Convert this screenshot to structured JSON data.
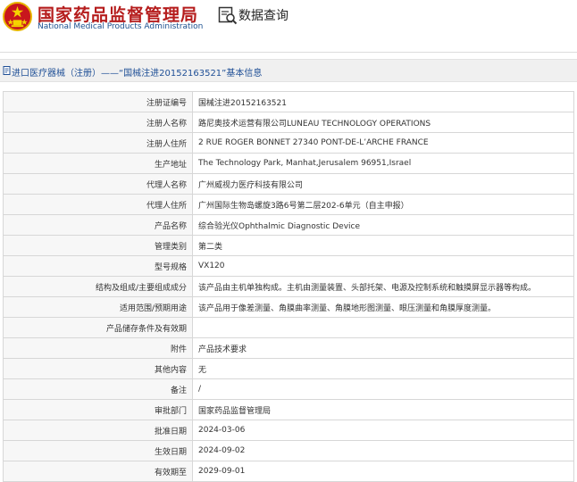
{
  "header": {
    "brand_cn": "国家药品监督管理局",
    "brand_en": "National Medical Products Administration",
    "search_label": "数据查询",
    "brand_color": "#b51c1c",
    "en_color": "#1b4f8f"
  },
  "breadcrumb": {
    "text": "进口医疗器械（注册）——“国械注进20152163521”基本信息",
    "color": "#1f4f96"
  },
  "details": {
    "rows": [
      {
        "label": "注册证编号",
        "value": "国械注进20152163521"
      },
      {
        "label": "注册人名称",
        "value": "路尼奥技术运营有限公司LUNEAU TECHNOLOGY OPERATIONS"
      },
      {
        "label": "注册人住所",
        "value": "2 RUE ROGER BONNET 27340 PONT-DE-L’ARCHE FRANCE"
      },
      {
        "label": "生产地址",
        "value": "The Technology Park, Manhat,Jerusalem 96951,Israel"
      },
      {
        "label": "代理人名称",
        "value": "广州威视力医疗科技有限公司"
      },
      {
        "label": "代理人住所",
        "value": "广州国际生物岛螺旋3路6号第二层202-6单元（自主申报）"
      },
      {
        "label": "产品名称",
        "value": "综合验光仪Ophthalmic Diagnostic Device"
      },
      {
        "label": "管理类别",
        "value": "第二类"
      },
      {
        "label": "型号规格",
        "value": "VX120"
      },
      {
        "label": "结构及组成/主要组成成分",
        "value": "该产品由主机单独构成。主机由测量装置、头部托架、电源及控制系统和触摸屏显示器等构成。"
      },
      {
        "label": "适用范围/预期用途",
        "value": "该产品用于像差测量、角膜曲率测量、角膜地形图测量、眼压测量和角膜厚度测量。"
      },
      {
        "label": "产品储存条件及有效期",
        "value": ""
      },
      {
        "label": "附件",
        "value": "产品技术要求"
      },
      {
        "label": "其他内容",
        "value": "无"
      },
      {
        "label": "备注",
        "value": "/"
      },
      {
        "label": "审批部门",
        "value": "国家药品监督管理局"
      },
      {
        "label": "批准日期",
        "value": "2024-03-06"
      },
      {
        "label": "生效日期",
        "value": "2024-09-02"
      },
      {
        "label": "有效期至",
        "value": "2029-09-01"
      }
    ]
  }
}
